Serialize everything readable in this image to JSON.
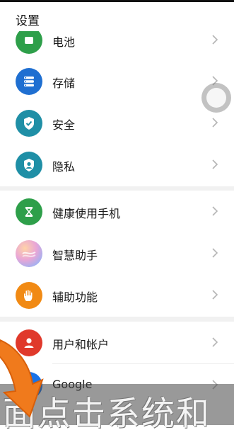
{
  "header": {
    "title": "设置"
  },
  "items": [
    {
      "label": "电池",
      "icon": "battery-icon",
      "color": "#2e9f4a"
    },
    {
      "label": "存储",
      "icon": "storage-icon",
      "color": "#1f6fd1"
    },
    {
      "label": "安全",
      "icon": "shield-icon",
      "color": "#1f8fa6"
    },
    {
      "label": "隐私",
      "icon": "privacy-icon",
      "color": "#1f8fa6"
    },
    {
      "label": "健康使用手机",
      "icon": "hourglass-icon",
      "color": "#2e9f4a"
    },
    {
      "label": "智慧助手",
      "icon": "assistant-icon",
      "color": "#c98bd8"
    },
    {
      "label": "辅助功能",
      "icon": "hand-icon",
      "color": "#f18a14"
    },
    {
      "label": "用户和帐户",
      "icon": "user-icon",
      "color": "#e0392b"
    },
    {
      "label": "Google",
      "icon": "google-icon",
      "color": "#1a73e8"
    }
  ],
  "overlay": {
    "caption": "面点击系统和"
  }
}
